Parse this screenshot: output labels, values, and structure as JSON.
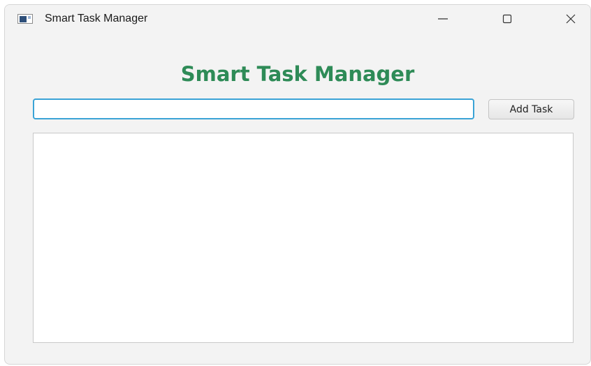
{
  "window": {
    "title": "Smart Task Manager",
    "icon": "app-window-icon",
    "controls": {
      "minimize_icon": "minimize-icon",
      "maximize_icon": "maximize-icon",
      "close_icon": "close-icon"
    }
  },
  "main": {
    "heading": "Smart Task Manager",
    "heading_color": "#2e8b57",
    "task_input": {
      "value": "",
      "placeholder": ""
    },
    "add_button_label": "Add Task",
    "task_list": {
      "items": []
    }
  }
}
